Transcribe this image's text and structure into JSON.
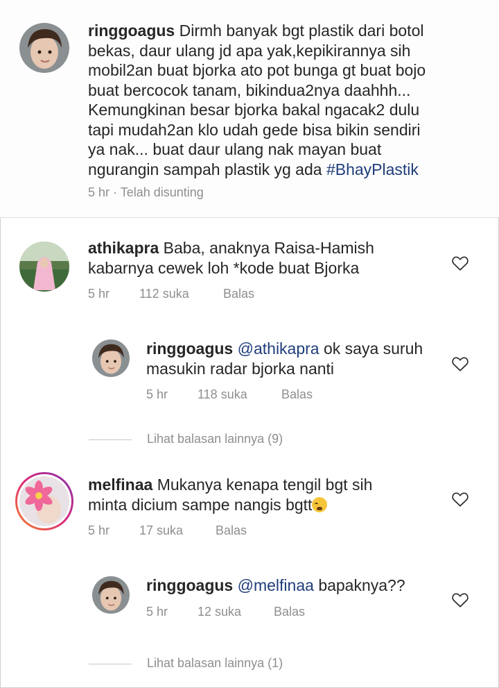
{
  "caption": {
    "username": "ringgoagus",
    "text_lines": [
      "Dirmh banyak bgt plastik dari botol",
      "bekas, daur ulang jd apa yak,kepikirannya sih",
      "mobil2an buat bjorka ato pot bunga gt buat bojo",
      "buat bercocok tanam, bikindua2nya daahhh...",
      "Kemungkinan besar bjorka bakal ngacak2 dulu",
      "tapi mudah2an klo udah gede bisa bikin sendiri",
      "ya nak... buat daur ulang nak mayan buat"
    ],
    "last_line_text": "ngurangin sampah plastik yg ada",
    "hashtag": "#BhayPlastik",
    "meta": "5 hr · Telah disunting"
  },
  "comments": [
    {
      "username": "athikapra",
      "line1": "Baba, anaknya Raisa-Hamish",
      "line2": "kabarnya cewek loh *kode buat Bjorka",
      "time": "5 hr",
      "likes": "112 suka",
      "reply": "Balas",
      "heart_icon": "heart-outline-icon"
    },
    {
      "username": "melfinaa",
      "line1": "Mukanya kenapa tengil bgt sih",
      "line2": "minta dicium sampe nangis bgtt",
      "emoji": "loudly-crying-face-emoji",
      "time": "5 hr",
      "likes": "17 suka",
      "reply": "Balas",
      "heart_icon": "heart-outline-icon"
    }
  ],
  "replies": [
    {
      "username": "ringgoagus",
      "mention": "@athikapra",
      "line1_rest": "ok saya suruh",
      "line2": "masukin radar bjorka nanti",
      "time": "5 hr",
      "likes": "118 suka",
      "reply": "Balas",
      "more": "Lihat balasan lainnya (9)"
    },
    {
      "username": "ringgoagus",
      "mention": "@melfinaa",
      "line1_rest": "bapaknya??",
      "time": "5 hr",
      "likes": "12 suka",
      "reply": "Balas",
      "more": "Lihat balasan lainnya (1)"
    }
  ],
  "colors": {
    "text": "#262626",
    "meta": "#8e8e8e",
    "link": "#1f3d7a",
    "story_ring_gradient": [
      "#f58529",
      "#dd2a7b"
    ]
  }
}
